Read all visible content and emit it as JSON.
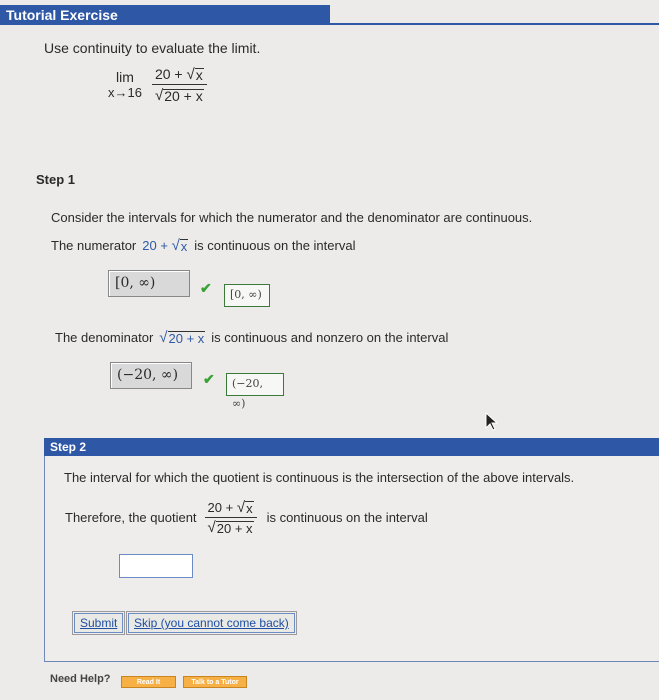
{
  "header": {
    "title": "Tutorial Exercise"
  },
  "problem": {
    "prompt": "Use continuity to evaluate the limit.",
    "lim": "lim",
    "approach": "x→16",
    "numerator_const": "20 +",
    "numerator_radicand": "x",
    "denominator_radicand": "20 + x"
  },
  "step1": {
    "label": "Step 1",
    "intro": "Consider the intervals for which the numerator and the denominator are continuous.",
    "numerator_prefix": "The numerator",
    "numerator_expr_const": "20 +",
    "numerator_expr_radicand": "x",
    "numerator_suffix": "is continuous on the interval",
    "numerator_answer": "[0, ∞)",
    "numerator_key": "[0, ∞)",
    "denominator_prefix": "The denominator",
    "denominator_expr_radicand": "20 + x",
    "denominator_suffix": "is continuous and nonzero on the interval",
    "denominator_answer": "(−20, ∞)",
    "denominator_key": "(−20, ∞)",
    "check_glyph": "✔"
  },
  "step2": {
    "label": "Step 2",
    "intro": "The interval for which the quotient is continuous is the intersection of the above intervals.",
    "quotient_prefix": "Therefore, the quotient",
    "quotient_suffix": "is continuous on the interval",
    "answer_value": ""
  },
  "actions": {
    "submit_label": "Submit",
    "skip_label": "Skip (you cannot come back)"
  },
  "help": {
    "label": "Need Help?",
    "read_label": "Read It",
    "talk_label": "Talk to a Tutor"
  },
  "colors": {
    "header_bg": "#2e57a6",
    "check": "#3aa335",
    "key_border": "#3c7a3c",
    "help_button": "#f6b045"
  }
}
